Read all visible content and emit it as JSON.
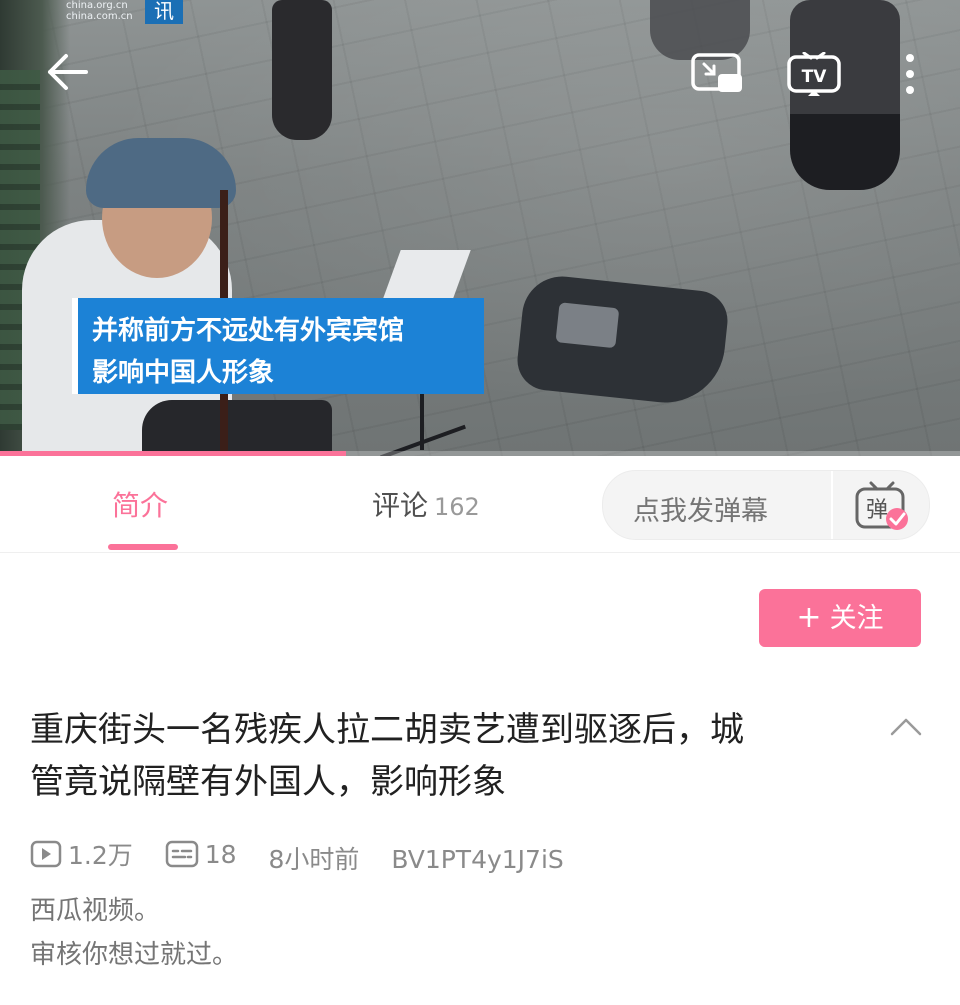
{
  "player": {
    "watermark_line1": "china.org.cn",
    "watermark_line2": "china.com.cn",
    "watermark_badge": "讯",
    "subtitle_line1": "并称前方不远处有外宾宾馆",
    "subtitle_line2": "影响中国人形象",
    "progress_fraction": 0.36,
    "tv_label": "TV"
  },
  "tabs": {
    "intro_label": "简介",
    "comments_label": "评论",
    "comments_count": "162",
    "danmaku_placeholder": "点我发弹幕",
    "danmaku_icon_char": "弹"
  },
  "info": {
    "follow_plus": "+",
    "follow_label": "关注",
    "title_line1": "重庆街头一名残疾人拉二胡卖艺遭到驱逐后，城",
    "title_line2": "管竟说隔壁有外国人，影响形象",
    "views": "1.2万",
    "danmaku_count": "18",
    "time": "8小时前",
    "bvid": "BV1PT4y1J7iS",
    "desc_line1": "西瓜视频。",
    "desc_line2": "审核你想过就过。"
  },
  "colors": {
    "accent": "#fb7299",
    "subtitle_bg": "#1c82d6"
  }
}
